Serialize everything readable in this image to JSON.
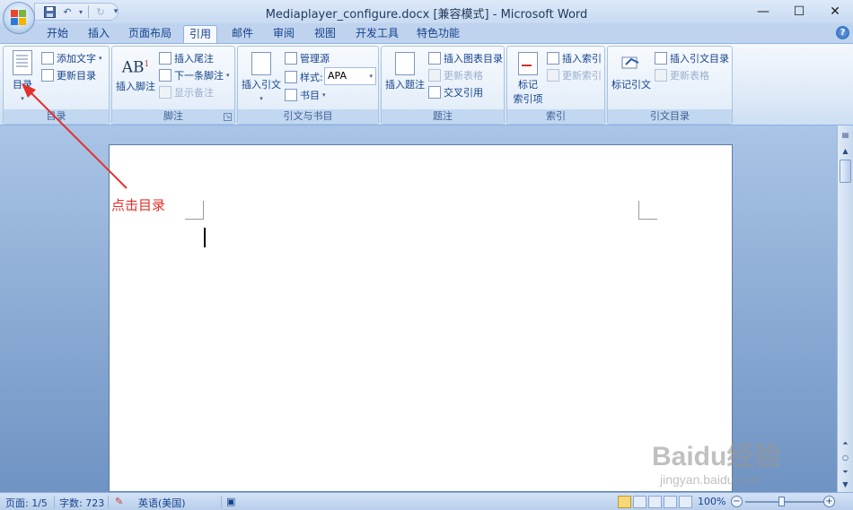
{
  "window": {
    "title": "Mediaplayer_configure.docx [兼容模式] - Microsoft Word",
    "minimize": "—",
    "maximize": "☐",
    "close": "✕"
  },
  "qat": {
    "save_icon": "save-icon",
    "undo": "↶",
    "redo": "↻",
    "customize": "▾"
  },
  "tabs": [
    {
      "label": "开始"
    },
    {
      "label": "插入"
    },
    {
      "label": "页面布局"
    },
    {
      "label": "引用"
    },
    {
      "label": "邮件"
    },
    {
      "label": "审阅"
    },
    {
      "label": "视图"
    },
    {
      "label": "开发工具"
    },
    {
      "label": "特色功能"
    }
  ],
  "active_tab": "引用",
  "ribbon": {
    "toc": {
      "label": "目录",
      "big": "目录",
      "add_text": "添加文字",
      "update": "更新目录"
    },
    "footnotes": {
      "label": "脚注",
      "insert_footnote": "插入脚注",
      "insert_endnote": "插入尾注",
      "next_footnote": "下一条脚注",
      "show_notes": "显示备注",
      "ab_glyph": "AB"
    },
    "citations": {
      "label": "引文与书目",
      "insert_citation": "插入引文",
      "manage_sources": "管理源",
      "style_label": "样式:",
      "style_value": "APA",
      "bibliography": "书目"
    },
    "captions": {
      "label": "题注",
      "insert_caption": "插入题注",
      "insert_table_of_figures": "插入图表目录",
      "update_table": "更新表格",
      "cross_reference": "交叉引用"
    },
    "index": {
      "label": "索引",
      "mark_entry": "标记\n索引项",
      "mark_line1": "标记",
      "mark_line2": "索引项",
      "insert_index": "插入索引",
      "update_index": "更新索引"
    },
    "toa": {
      "label": "引文目录",
      "mark_citation": "标记引文",
      "insert_toa": "插入引文目录",
      "update_table": "更新表格"
    }
  },
  "annotation": {
    "text": "点击目录",
    "color": "#e2302a"
  },
  "status": {
    "page": "页面: 1/5",
    "words": "字数: 723",
    "language": "英语(美国)",
    "zoom": "100%"
  },
  "watermark": {
    "brand": "Baidu经验",
    "url": "jingyan.baidu.com"
  }
}
